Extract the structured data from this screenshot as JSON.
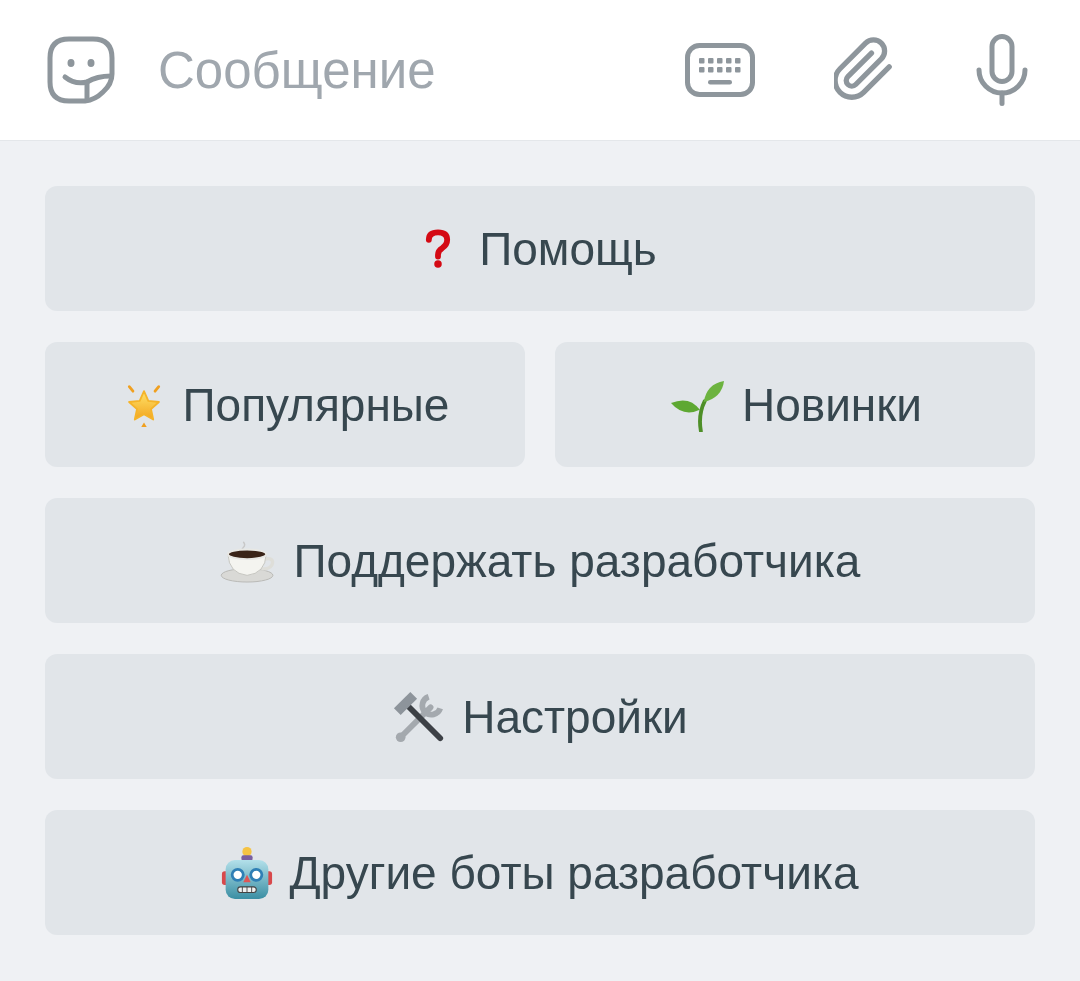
{
  "input_bar": {
    "placeholder": "Сообщение"
  },
  "keyboard": {
    "rows": [
      [
        {
          "label": "Помощь"
        }
      ],
      [
        {
          "label": "Популярные"
        },
        {
          "label": "Новинки"
        }
      ],
      [
        {
          "label": "Поддержать разработчика"
        }
      ],
      [
        {
          "label": "Настройки"
        }
      ],
      [
        {
          "label": "Другие боты разработчика"
        }
      ]
    ]
  }
}
